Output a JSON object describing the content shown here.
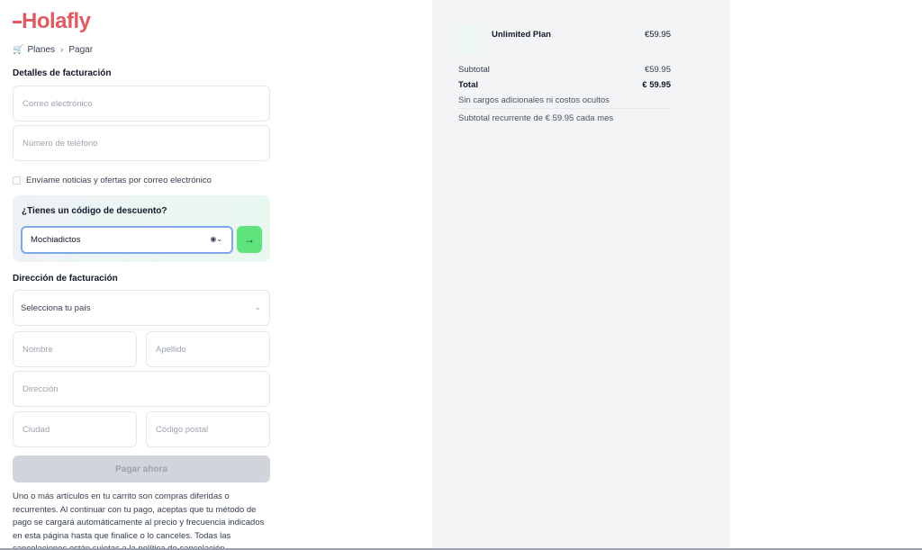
{
  "brand": {
    "logo_text": "Holafly",
    "accent": "#e05a62"
  },
  "breadcrumb": {
    "icon": "cart-icon",
    "items": [
      "Planes",
      "Pagar"
    ]
  },
  "billing": {
    "title": "Detalles de facturación",
    "email_placeholder": "Correo electrónico",
    "phone_placeholder": "Número de teléfono",
    "newsletter_label": "Envíame noticias y ofertas por correo electrónico"
  },
  "discount": {
    "title": "¿Tienes un código de descuento?",
    "code_value": "Mochiadictos",
    "icon": "eye-icon",
    "submit_icon": "arrow-right-icon"
  },
  "address": {
    "title": "Dirección de facturación",
    "country_placeholder": "Selecciona tu país",
    "first_name_placeholder": "Nombre",
    "last_name_placeholder": "Apellido",
    "address_placeholder": "Dirección",
    "city_placeholder": "Ciudad",
    "postal_placeholder": "Código postal"
  },
  "pay_button": "Pagar ahora",
  "legal_text": "Uno o más artículos en tu carrito son compras diferidas o recurrentes. Al continuar con tu pago, aceptas que tu método de pago se cargará automáticamente al precio y frecuencia indicados en esta página hasta que finalice o lo canceles. Todas las cancelaciones están sujetas a la política de cancelación.",
  "summary": {
    "item_name": "Unlimited Plan",
    "item_price": "€59.95",
    "subtotal_label": "Subtotal",
    "subtotal_value": "€59.95",
    "total_label": "Total",
    "total_value": "€ 59.95",
    "no_fees_note": "Sin cargos adicionales ni costos ocultos",
    "recurring_note": "Subtotal recurrente de € 59.95 cada mes"
  }
}
